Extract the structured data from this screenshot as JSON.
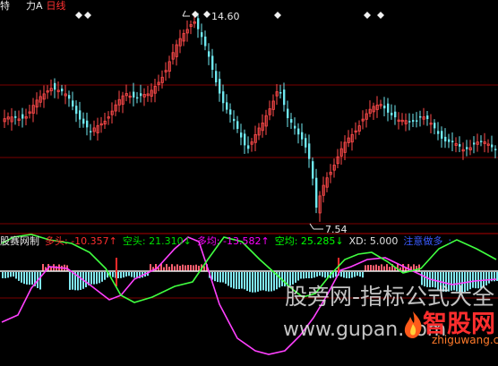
{
  "top_bar": {
    "left_label": "特",
    "mid_label": "力A",
    "period_label": "日线"
  },
  "price_labels": {
    "high": "14.60",
    "low": "7.54"
  },
  "indicator_bar": {
    "name": "股赛网制",
    "items": [
      {
        "text": "多头: -10.357↑",
        "color": "#ff2e2e"
      },
      {
        "text": "空头: 21.310↓",
        "color": "#00e000"
      },
      {
        "text": "多均: -13.582↑",
        "color": "#ff00ff"
      },
      {
        "text": "空均: 25.285↓",
        "color": "#00ff00"
      },
      {
        "text": "XD: 5.000",
        "color": "#e0e0e0"
      },
      {
        "text": "注意做多",
        "color": "#3a5bff"
      },
      {
        "text": ":",
        "color": "#3a5bff"
      }
    ]
  },
  "watermark": {
    "line1": "股旁网-指标公式大全",
    "line2": "www.gupan.com"
  },
  "logo": {
    "brand": "智股网",
    "site": "zhiguwang.cn"
  },
  "colors": {
    "up": "#ff4a4a",
    "down": "#6fe8f0",
    "grid": "#7a0000",
    "bull": "#ff40ff",
    "bear": "#40ff40"
  }
}
